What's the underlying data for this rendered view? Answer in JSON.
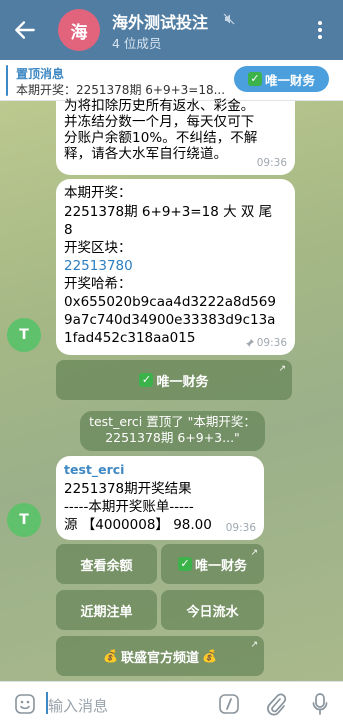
{
  "header": {
    "avatar_letter": "海",
    "title": "海外测试投注",
    "subtitle": "4 位成员"
  },
  "pinned": {
    "title": "置顶消息",
    "text": "本期开奖：2251378期 6+9+3=18...",
    "button_label": "唯一财务"
  },
  "messages": {
    "m1": {
      "lines": [
        "为将扣除历史所有返水、彩金。",
        "并冻结分数一个月，每天仅可下",
        "分账户余额10%。不纠结，不解",
        "释，请各大水军自行绕道。"
      ],
      "time": "09:36"
    },
    "m2": {
      "line1": "本期开奖：",
      "line2": "2251378期 6+9+3=18 大 双 尾",
      "line3": "8",
      "line4": "开奖区块：",
      "block_link": "22513780",
      "line5": "开奖哈希：",
      "hash1": "0x655020b9caa4d3222a8d569",
      "hash2": "9a7c740d34900e33383d9c13a",
      "hash3": "1fad452c318aa015",
      "time": "09:36"
    },
    "avatar_letter": "T",
    "finance_button": "唯一财务",
    "service": {
      "line1": "test_erci 置顶了 \"本期开奖：",
      "line2": "2251378期 6+9+3...\""
    },
    "m3": {
      "sender": "test_erci",
      "line1": "2251378期开奖结果",
      "line2": "-----本期开奖账单-----",
      "line3": "源 【4000008】 98.00",
      "time": "09:36"
    }
  },
  "keyboard": {
    "check_balance": "查看余额",
    "finance": "唯一财务",
    "recent_bets": "近期注单",
    "today_flow": "今日流水",
    "official_channel": "联盛官方频道"
  },
  "input": {
    "placeholder": "输入消息"
  },
  "colors": {
    "header_bg": "#517da2",
    "accent": "#3e88c4",
    "inline_button_bg": "#547649"
  }
}
